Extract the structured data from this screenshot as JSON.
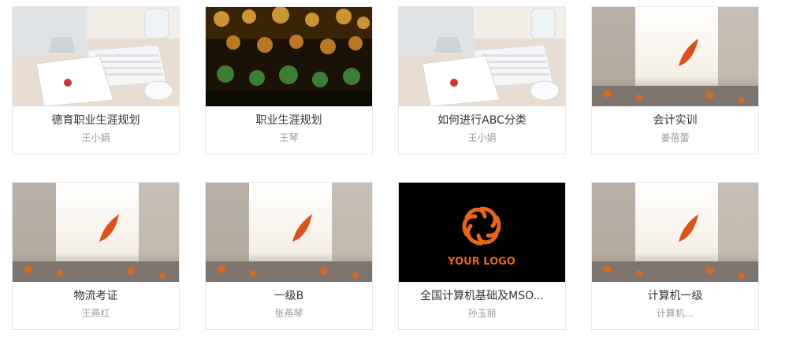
{
  "courses": [
    {
      "title": "德育职业生涯规划",
      "author": "王小娟",
      "thumbnail": "desk-keyboard-photo"
    },
    {
      "title": "职业生涯规划",
      "author": "王琴",
      "thumbnail": "bokeh-bottles-photo"
    },
    {
      "title": "如何进行ABC分类",
      "author": "王小娟",
      "thumbnail": "desk-keyboard-photo"
    },
    {
      "title": "会计实训",
      "author": "姜蓓蕾",
      "thumbnail": "autumn-leaf-photo"
    },
    {
      "title": "物流考证",
      "author": "王燕红",
      "thumbnail": "autumn-leaf-photo"
    },
    {
      "title": "一级B",
      "author": "张燕琴",
      "thumbnail": "autumn-leaf-photo"
    },
    {
      "title": "全国计算机基础及MSO...",
      "author": "孙玉丽",
      "thumbnail": "your-logo-placeholder",
      "logo_text": "YOUR LOGO"
    },
    {
      "title": "计算机一级",
      "author": "计算机...",
      "thumbnail": "autumn-leaf-photo"
    }
  ],
  "colors": {
    "logo_orange": "#e8661c",
    "border": "#e6e6e6",
    "title": "#333333",
    "author": "#999999"
  }
}
